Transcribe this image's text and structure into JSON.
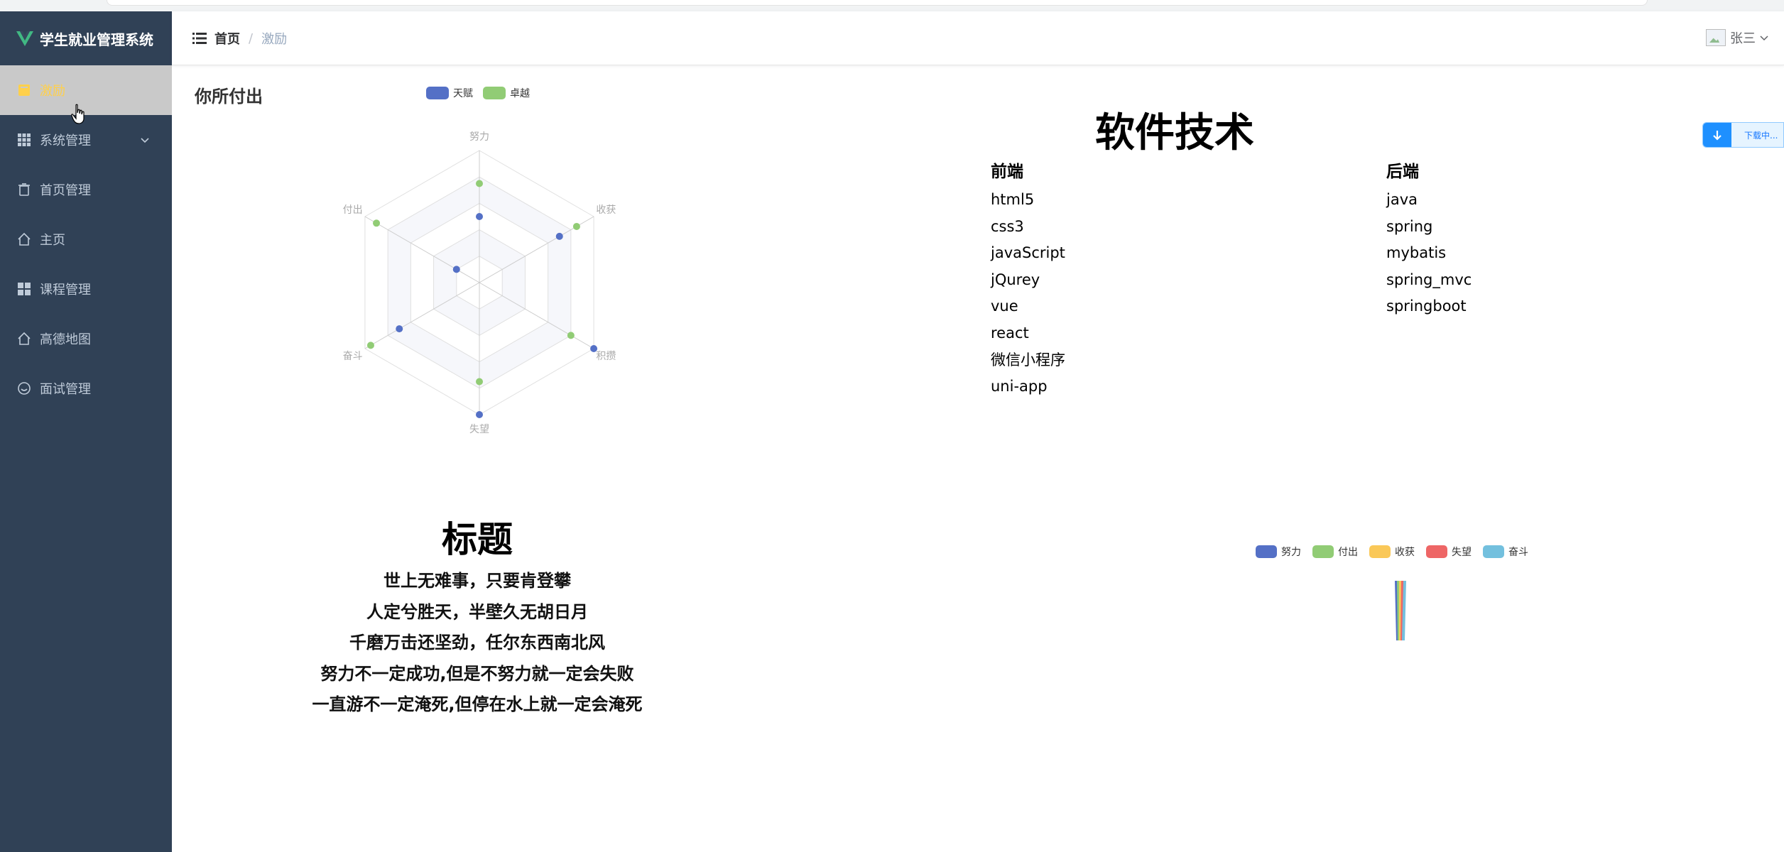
{
  "app": {
    "title": "学生就业管理系统"
  },
  "sidebar": {
    "items": [
      {
        "label": "激励",
        "icon": "book-icon",
        "active": true
      },
      {
        "label": "系统管理",
        "icon": "grid-icon",
        "expandable": true
      },
      {
        "label": "首页管理",
        "icon": "trash-icon"
      },
      {
        "label": "主页",
        "icon": "home-icon"
      },
      {
        "label": "课程管理",
        "icon": "apps-icon"
      },
      {
        "label": "高德地图",
        "icon": "home-icon"
      },
      {
        "label": "面试管理",
        "icon": "smile-icon"
      }
    ]
  },
  "navbar": {
    "breadcrumb": [
      "首页",
      "激励"
    ],
    "separator": "/",
    "user": "张三"
  },
  "radar": {
    "title": "你所付出",
    "chart_data": {
      "type": "radar",
      "indicators": [
        "努力",
        "收获",
        "积攒",
        "失望",
        "奋斗",
        "付出"
      ],
      "series": [
        {
          "name": "天赋",
          "color": "#5470c6",
          "values": [
            0.5,
            0.7,
            1.0,
            1.0,
            0.7,
            0.2
          ]
        },
        {
          "name": "卓越",
          "color": "#91cc75",
          "values": [
            0.75,
            0.85,
            0.8,
            0.75,
            0.95,
            0.9
          ]
        }
      ]
    }
  },
  "tech": {
    "title": "软件技术",
    "frontend": {
      "heading": "前端",
      "items": [
        "html5",
        "css3",
        "javaScript",
        "jQurey",
        "vue",
        "react",
        "微信小程序",
        "uni-app"
      ]
    },
    "backend": {
      "heading": "后端",
      "items": [
        "java",
        "spring",
        "mybatis",
        "spring_mvc",
        "springboot"
      ]
    }
  },
  "poem": {
    "title": "标题",
    "lines": [
      "世上无难事，只要肯登攀",
      "人定兮胜天，半壁久无胡日月",
      "千磨万击还坚劲，任尔东西南北风",
      "努力不一定成功,但是不努力就一定会失败",
      "一直游不一定淹死,但停在水上就一定会淹死"
    ]
  },
  "barchart": {
    "chart_data": {
      "type": "bar",
      "series": [
        {
          "name": "努力",
          "color": "#5470c6"
        },
        {
          "name": "付出",
          "color": "#91cc75"
        },
        {
          "name": "收获",
          "color": "#fac858"
        },
        {
          "name": "失望",
          "color": "#ee6666"
        },
        {
          "name": "奋斗",
          "color": "#73c0de"
        }
      ]
    }
  },
  "download": {
    "label": "下载中..."
  }
}
